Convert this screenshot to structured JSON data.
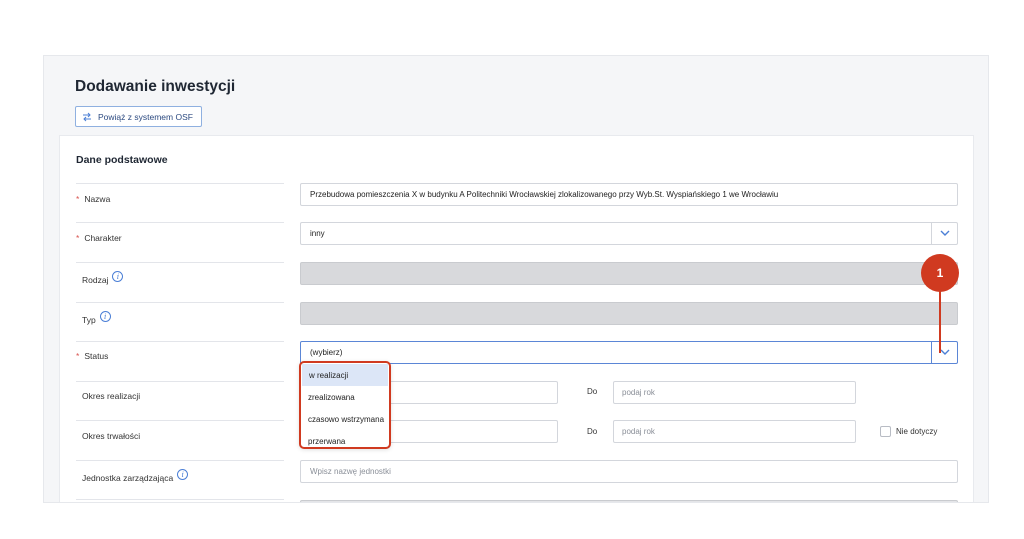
{
  "header": {
    "title": "Dodawanie inwestycji",
    "osf_button": "Powiąż z systemem OSF"
  },
  "section": {
    "title": "Dane podstawowe"
  },
  "fields": {
    "nazwa": {
      "label": "Nazwa",
      "value": "Przebudowa pomieszczenia X w budynku A Politechniki Wrocławskiej zlokalizowanego przy Wyb.St. Wyspiańskiego 1 we Wrocławiu"
    },
    "charakter": {
      "label": "Charakter",
      "value": "inny"
    },
    "rodzaj": {
      "label": "Rodzaj"
    },
    "typ": {
      "label": "Typ"
    },
    "status": {
      "label": "Status",
      "value": "(wybierz)"
    },
    "okres_realizacji": {
      "label": "Okres realizacji",
      "do_label": "Do",
      "placeholder": "podaj rok"
    },
    "okres_trwalosci": {
      "label": "Okres trwałości",
      "do_label": "Do",
      "placeholder": "podaj rok",
      "checkbox_label": "Nie dotyczy"
    },
    "jednostka": {
      "label": "Jednostka zarządzająca",
      "placeholder": "Wpisz nazwę jednostki"
    }
  },
  "status_options": [
    "w realizacji",
    "zrealizowana",
    "czasowo wstrzymana",
    "przerwana"
  ],
  "callout": {
    "number": "1"
  },
  "colors": {
    "accent": "#5b86d6",
    "callout": "#d03a20",
    "required": "#d9534f"
  }
}
